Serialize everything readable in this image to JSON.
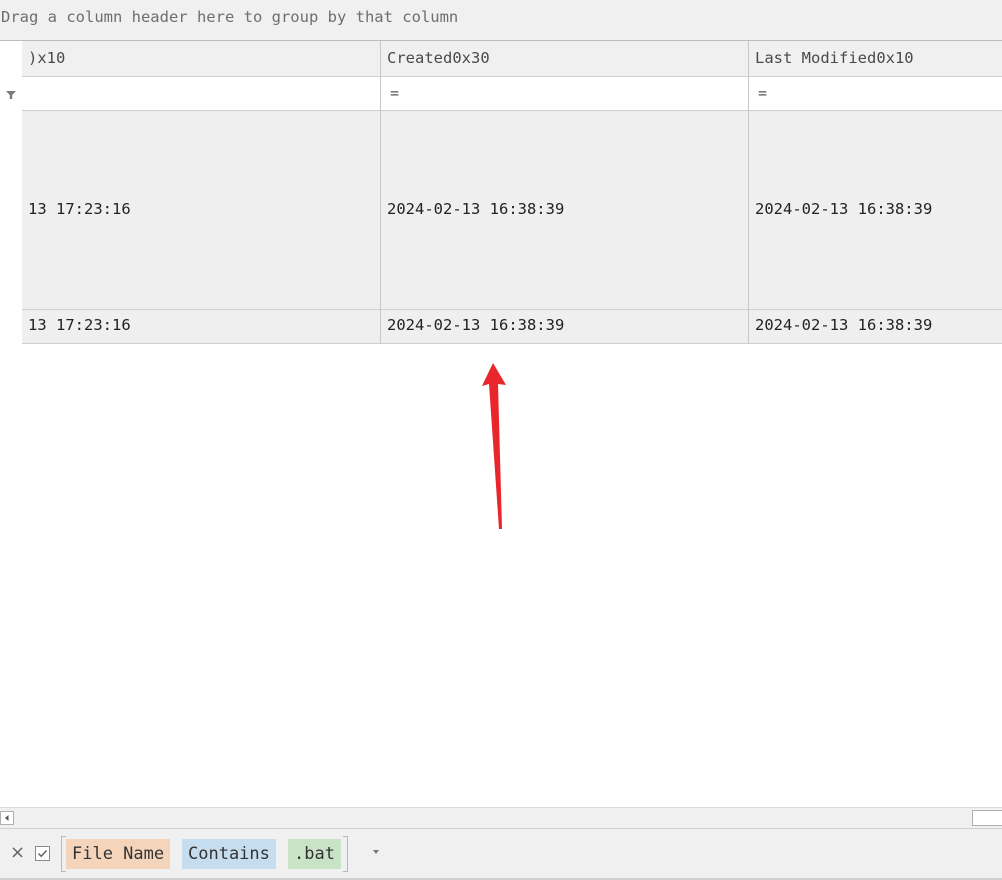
{
  "group_panel": {
    "text": "Drag a column header here to group by that column"
  },
  "columns": [
    {
      "header": ")x10",
      "filter": "",
      "rows": [
        "13 17:23:16",
        "13 17:23:16"
      ]
    },
    {
      "header": "Created0x30",
      "filter": "=",
      "rows": [
        "2024-02-13 16:38:39",
        "2024-02-13 16:38:39"
      ]
    },
    {
      "header": "Last Modified0x10",
      "filter": "=",
      "rows": [
        "2024-02-13 16:38:39",
        "2024-02-13 16:38:39"
      ]
    }
  ],
  "filter_bar": {
    "close_glyph": "×",
    "field": "File Name",
    "operator": "Contains",
    "value": ".bat"
  },
  "icons": [
    "filter-icon",
    "close-icon",
    "checkbox-check-icon",
    "dropdown-arrow-icon",
    "scroll-left-icon",
    "annotation-arrow-icon"
  ],
  "colors": {
    "field_token": "#f4d5bb",
    "operator_token": "#c6dcef",
    "value_token": "#c9e3c6",
    "annotation_arrow": "#e8262b"
  }
}
